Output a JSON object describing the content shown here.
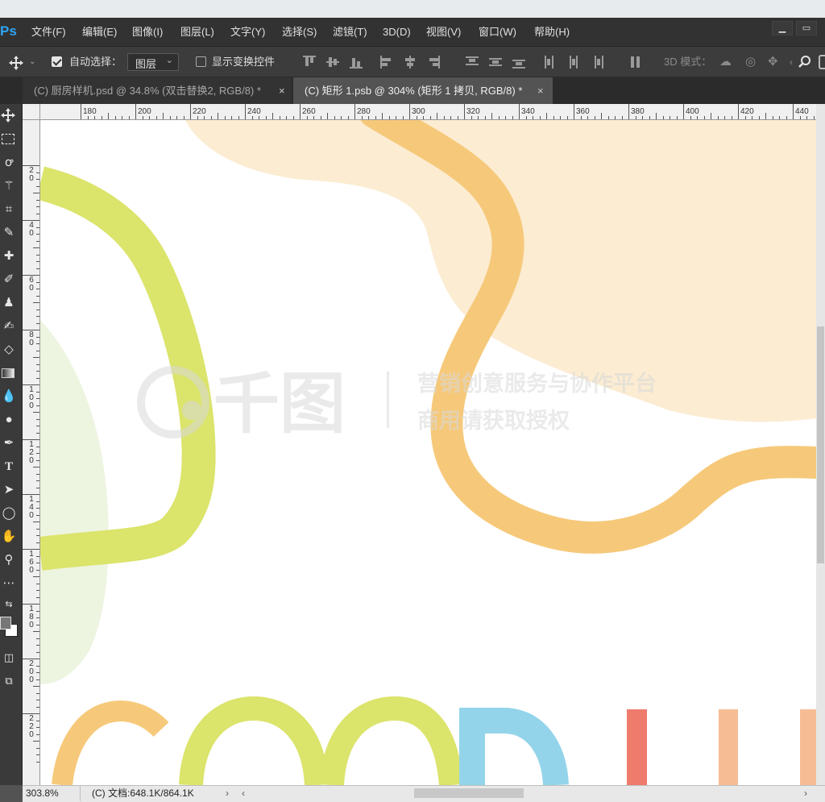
{
  "app": {
    "logo": "Ps"
  },
  "menu": [
    "文件(F)",
    "编辑(E)",
    "图像(I)",
    "图层(L)",
    "文字(Y)",
    "选择(S)",
    "滤镜(T)",
    "3D(D)",
    "视图(V)",
    "窗口(W)",
    "帮助(H)"
  ],
  "window_controls": {
    "minimize": "▁",
    "restore": "▭"
  },
  "options": {
    "auto_select_label": "自动选择：",
    "auto_select_checked": true,
    "target_value": "图层",
    "show_transform_label": "显示变换控件",
    "show_transform_checked": false,
    "mode3d_label": "3D 模式："
  },
  "tabs": [
    {
      "label": "(C) 厨房样机.psd @ 34.8% (双击替换2, RGB/8) *",
      "active": false,
      "close": "×"
    },
    {
      "label": "(C) 矩形 1.psb @ 304% (矩形 1 拷贝, RGB/8) *",
      "active": true,
      "close": "×"
    }
  ],
  "ruler": {
    "h": [
      "180",
      "200",
      "220",
      "240",
      "260",
      "280",
      "300",
      "320",
      "340",
      "360",
      "380",
      "400",
      "420",
      "440"
    ],
    "v": [
      "2 0",
      "4 0",
      "6 0",
      "8 0",
      "1 0 0",
      "1 2 0",
      "1 4 0",
      "1 6 0",
      "1 8 0",
      "2 0 0",
      "2 2 0"
    ]
  },
  "canvas": {
    "watermark_logo": "千图",
    "watermark_line1": "营销创意服务与协作平台",
    "watermark_line2": "商用请获取授权",
    "colors": {
      "orange": "#f6c97a",
      "cream": "#fcecd2",
      "lime": "#dbe46b",
      "pale_green": "#edf4e0",
      "blue": "#94d4ea",
      "red": "#ef7b6d",
      "peach": "#f6bd95"
    }
  },
  "status": {
    "zoom": "303.8%",
    "doc": "(C) 文档:648.1K/864.1K",
    "arrow": "›",
    "scroll_left": "‹",
    "scroll_right": "›"
  },
  "tools": [
    "move-tool",
    "marquee-tool",
    "lasso-tool",
    "magic-wand-tool",
    "crop-tool",
    "eyedropper-tool",
    "healing-brush-tool",
    "brush-tool",
    "stamp-tool",
    "history-brush-tool",
    "eraser-tool",
    "gradient-tool",
    "blur-tool",
    "dodge-tool",
    "pen-tool",
    "type-tool",
    "path-selection-tool",
    "shape-tool",
    "hand-tool",
    "zoom-tool",
    "more-tools"
  ]
}
